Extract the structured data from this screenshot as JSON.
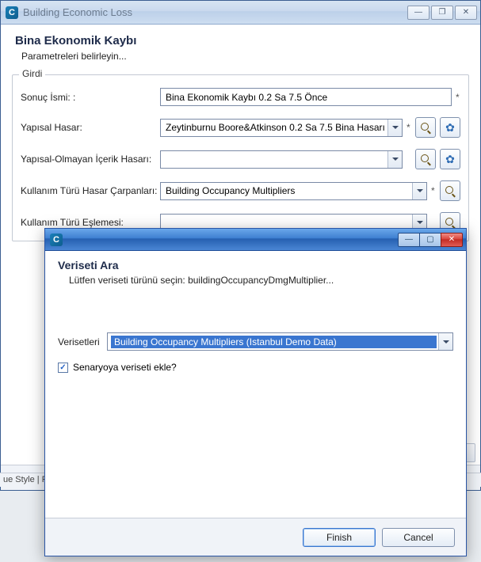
{
  "parentWindow": {
    "title": "Building Economic Loss",
    "header": {
      "title": "Bina Ekonomik Kaybı",
      "subtitle": "Parametreleri belirleyin..."
    },
    "fieldsetLabel": "Girdi",
    "rows": {
      "sonuc": {
        "label": "Sonuç İsmi: :",
        "value": "Bina Ekonomik Kaybı 0.2 Sa 7.5 Önce"
      },
      "yapisalHasar": {
        "label": "Yapısal Hasar:",
        "value": "Zeytinburnu Boore&Atkinson 0.2 Sa 7.5 Bina Hasarı"
      },
      "icerikHasar": {
        "label": "Yapısal-Olmayan İçerik Hasarı:",
        "value": ""
      },
      "hasarCarpan": {
        "label": "Kullanım Türü Hasar Çarpanları:",
        "value": "Building Occupancy Multipliers"
      },
      "eslemesi": {
        "label": "Kullanım Türü Eşlemesi:",
        "value": ""
      }
    }
  },
  "statusBar": "ue Style | R",
  "dialog": {
    "header": {
      "title": "Veriseti Ara",
      "hint": "Lütfen veriseti türünü seçin: buildingOccupancyDmgMultiplier..."
    },
    "datasetsLabel": "Verisetleri",
    "selected": "Building Occupancy Multipliers   (Istanbul Demo Data)",
    "checkbox": {
      "checked": true,
      "label": "Senaryoya veriseti ekle?"
    },
    "buttons": {
      "finish": "Finish",
      "cancel": "Cancel"
    }
  },
  "glyphs": {
    "minimize": "—",
    "maximize": "▢",
    "close": "✕",
    "restore": "❐",
    "gear": "✿",
    "check": "✓"
  }
}
